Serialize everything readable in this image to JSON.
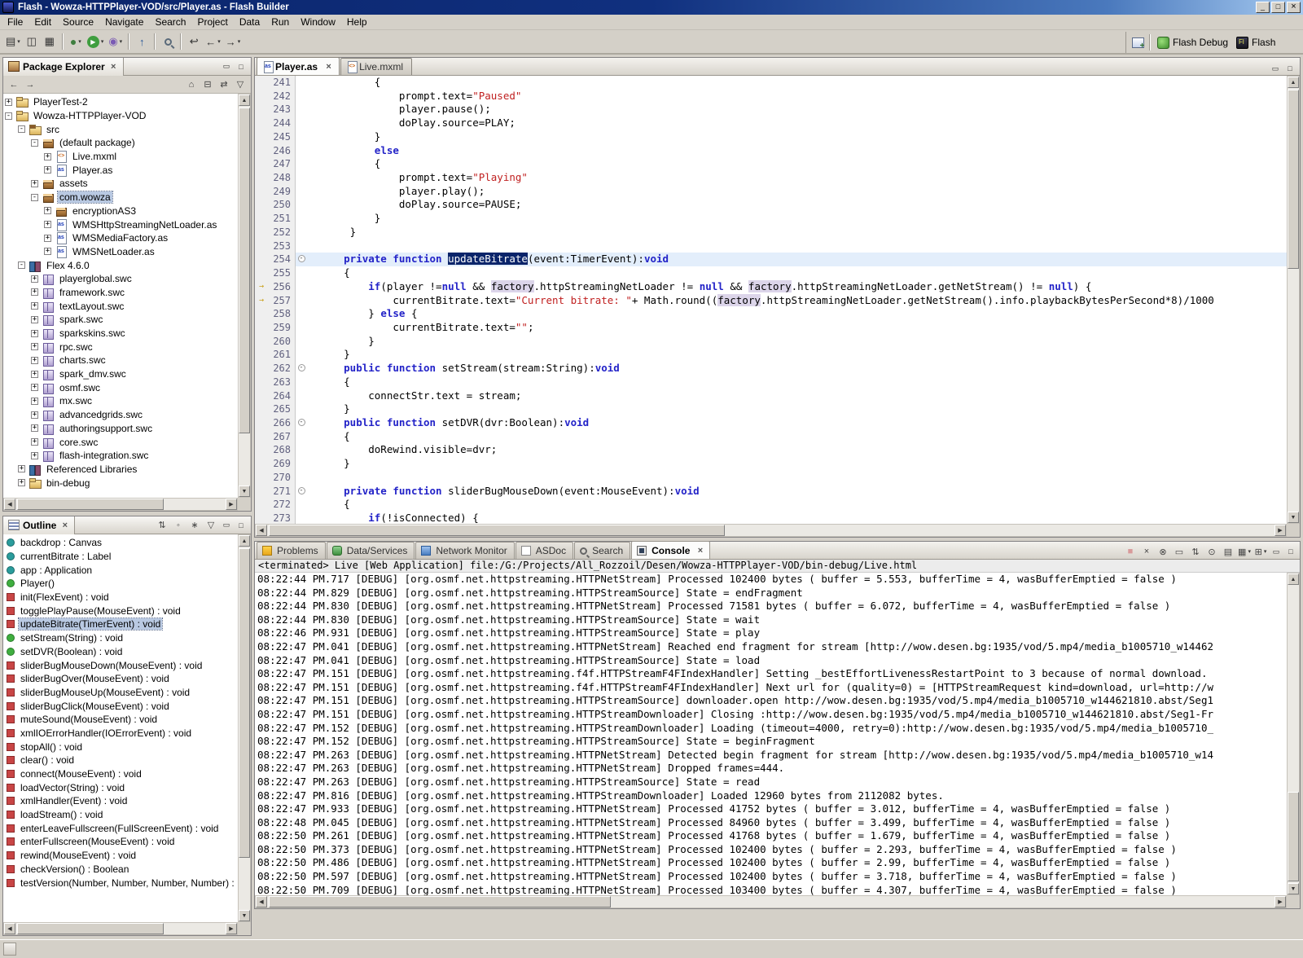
{
  "window": {
    "title": "Flash - Wowza-HTTPPlayer-VOD/src/Player.as - Flash Builder",
    "menus": [
      "File",
      "Edit",
      "Source",
      "Navigate",
      "Search",
      "Project",
      "Data",
      "Run",
      "Window",
      "Help"
    ]
  },
  "toolbar": {
    "buttons": [
      {
        "name": "new",
        "glyph": "▤",
        "dropdown": true
      },
      {
        "name": "save",
        "glyph": "◫"
      },
      {
        "name": "print",
        "glyph": "▦"
      },
      {
        "sep": true
      },
      {
        "name": "debug",
        "glyph": "●",
        "cls": "g-debug",
        "dropdown": true
      },
      {
        "name": "run",
        "glyph": "▶",
        "cls": "g-run",
        "dropdown": true
      },
      {
        "name": "profile",
        "glyph": "◉",
        "cls": "g-prof",
        "dropdown": true
      },
      {
        "sep": true
      },
      {
        "name": "export-release-build",
        "glyph": "↑",
        "cls": "g-exp"
      },
      {
        "sep": true
      },
      {
        "name": "search",
        "search": true
      },
      {
        "sep": true
      },
      {
        "name": "last-edit-location",
        "glyph": "↩"
      },
      {
        "name": "back",
        "glyph": "←",
        "dropdown": true
      },
      {
        "name": "forward",
        "glyph": "→",
        "dropdown": true
      }
    ],
    "perspectives": [
      {
        "label": "Flash Debug",
        "icon": "flash-debug"
      },
      {
        "label": "Flash",
        "icon": "flash"
      }
    ]
  },
  "package_explorer": {
    "title": "Package Explorer",
    "toolbar_left": [
      {
        "name": "back-history",
        "glyph": "←"
      },
      {
        "name": "forward-history",
        "glyph": "→"
      }
    ],
    "toolbar_right": [
      {
        "name": "go-up",
        "glyph": "⌂"
      },
      {
        "name": "collapse-all",
        "glyph": "⊟"
      },
      {
        "name": "link-with-editor",
        "glyph": "⇄"
      },
      {
        "name": "view-menu",
        "glyph": "▽"
      }
    ],
    "items": [
      {
        "label": "PlayerTest-2",
        "depth": 0,
        "icon": "project",
        "exp": "+"
      },
      {
        "label": "Wowza-HTTPPlayer-VOD",
        "depth": 0,
        "icon": "project",
        "exp": "-"
      },
      {
        "label": "src",
        "depth": 1,
        "icon": "src",
        "exp": "-"
      },
      {
        "label": "(default package)",
        "depth": 2,
        "icon": "package",
        "exp": "-"
      },
      {
        "label": "Live.mxml",
        "depth": 3,
        "icon": "mxml",
        "exp": "+"
      },
      {
        "label": "Player.as",
        "depth": 3,
        "icon": "as",
        "exp": "+"
      },
      {
        "label": "assets",
        "depth": 2,
        "icon": "package",
        "exp": "+"
      },
      {
        "label": "com.wowza",
        "depth": 2,
        "icon": "package",
        "exp": "-",
        "selected": true
      },
      {
        "label": "encryptionAS3",
        "depth": 3,
        "icon": "package",
        "exp": "+"
      },
      {
        "label": "WMSHttpStreamingNetLoader.as",
        "depth": 3,
        "icon": "as",
        "exp": "+"
      },
      {
        "label": "WMSMediaFactory.as",
        "depth": 3,
        "icon": "as",
        "exp": "+"
      },
      {
        "label": "WMSNetLoader.as",
        "depth": 3,
        "icon": "as",
        "exp": "+"
      },
      {
        "label": "Flex 4.6.0",
        "depth": 1,
        "icon": "lib",
        "exp": "-"
      },
      {
        "label": "playerglobal.swc",
        "depth": 2,
        "icon": "swc",
        "exp": "+"
      },
      {
        "label": "framework.swc",
        "depth": 2,
        "icon": "swc",
        "exp": "+"
      },
      {
        "label": "textLayout.swc",
        "depth": 2,
        "icon": "swc",
        "exp": "+"
      },
      {
        "label": "spark.swc",
        "depth": 2,
        "icon": "swc",
        "exp": "+"
      },
      {
        "label": "sparkskins.swc",
        "depth": 2,
        "icon": "swc",
        "exp": "+"
      },
      {
        "label": "rpc.swc",
        "depth": 2,
        "icon": "swc",
        "exp": "+"
      },
      {
        "label": "charts.swc",
        "depth": 2,
        "icon": "swc",
        "exp": "+"
      },
      {
        "label": "spark_dmv.swc",
        "depth": 2,
        "icon": "swc",
        "exp": "+"
      },
      {
        "label": "osmf.swc",
        "depth": 2,
        "icon": "swc",
        "exp": "+"
      },
      {
        "label": "mx.swc",
        "depth": 2,
        "icon": "swc",
        "exp": "+"
      },
      {
        "label": "advancedgrids.swc",
        "depth": 2,
        "icon": "swc",
        "exp": "+"
      },
      {
        "label": "authoringsupport.swc",
        "depth": 2,
        "icon": "swc",
        "exp": "+"
      },
      {
        "label": "core.swc",
        "depth": 2,
        "icon": "swc",
        "exp": "+"
      },
      {
        "label": "flash-integration.swc",
        "depth": 2,
        "icon": "swc",
        "exp": "+"
      },
      {
        "label": "Referenced Libraries",
        "depth": 1,
        "icon": "lib",
        "exp": "+"
      },
      {
        "label": "bin-debug",
        "depth": 1,
        "icon": "folder",
        "exp": "+"
      }
    ]
  },
  "outline": {
    "title": "Outline",
    "toolbar": [
      {
        "name": "sort",
        "glyph": "⇅"
      },
      {
        "name": "hide-fields",
        "glyph": "◦"
      },
      {
        "name": "hide-static",
        "glyph": "∗"
      },
      {
        "name": "outline-view-menu",
        "glyph": "▽"
      }
    ],
    "items": [
      {
        "label": "backdrop : Canvas",
        "kind": "field"
      },
      {
        "label": "currentBitrate : Label",
        "kind": "field"
      },
      {
        "label": "app : Application",
        "kind": "field"
      },
      {
        "label": "Player()",
        "kind": "public"
      },
      {
        "label": "init(FlexEvent) : void",
        "kind": "private"
      },
      {
        "label": "togglePlayPause(MouseEvent) : void",
        "kind": "private"
      },
      {
        "label": "updateBitrate(TimerEvent) : void",
        "kind": "private",
        "selected": true
      },
      {
        "label": "setStream(String) : void",
        "kind": "public"
      },
      {
        "label": "setDVR(Boolean) : void",
        "kind": "public"
      },
      {
        "label": "sliderBugMouseDown(MouseEvent) : void",
        "kind": "private"
      },
      {
        "label": "sliderBugOver(MouseEvent) : void",
        "kind": "private"
      },
      {
        "label": "sliderBugMouseUp(MouseEvent) : void",
        "kind": "private"
      },
      {
        "label": "sliderBugClick(MouseEvent) : void",
        "kind": "private"
      },
      {
        "label": "muteSound(MouseEvent) : void",
        "kind": "private"
      },
      {
        "label": "xmlIOErrorHandler(IOErrorEvent) : void",
        "kind": "private"
      },
      {
        "label": "stopAll() : void",
        "kind": "private"
      },
      {
        "label": "clear() : void",
        "kind": "private"
      },
      {
        "label": "connect(MouseEvent) : void",
        "kind": "private"
      },
      {
        "label": "loadVector(String) : void",
        "kind": "private"
      },
      {
        "label": "xmlHandler(Event) : void",
        "kind": "private"
      },
      {
        "label": "loadStream() : void",
        "kind": "private"
      },
      {
        "label": "enterLeaveFullscreen(FullScreenEvent) : void",
        "kind": "private"
      },
      {
        "label": "enterFullscreen(MouseEvent) : void",
        "kind": "private"
      },
      {
        "label": "rewind(MouseEvent) : void",
        "kind": "private"
      },
      {
        "label": "checkVersion() : Boolean",
        "kind": "private"
      },
      {
        "label": "testVersion(Number, Number, Number, Number) : Boolean",
        "kind": "private"
      }
    ]
  },
  "editor": {
    "tabs": [
      {
        "label": "Player.as",
        "icon": "as",
        "active": true
      },
      {
        "label": "Live.mxml",
        "icon": "mxml",
        "active": false
      }
    ],
    "keywords": [
      "private",
      "public",
      "function",
      "if",
      "else",
      "null",
      "void"
    ],
    "lines": [
      {
        "n": 241,
        "t": "           {"
      },
      {
        "n": 242,
        "t": "               prompt.text=\"Paused\""
      },
      {
        "n": 243,
        "t": "               player.pause();"
      },
      {
        "n": 244,
        "t": "               doPlay.source=PLAY;"
      },
      {
        "n": 245,
        "t": "           }"
      },
      {
        "n": 246,
        "t": "           else"
      },
      {
        "n": 247,
        "t": "           {"
      },
      {
        "n": 248,
        "t": "               prompt.text=\"Playing\""
      },
      {
        "n": 249,
        "t": "               player.play();"
      },
      {
        "n": 250,
        "t": "               doPlay.source=PAUSE;"
      },
      {
        "n": 251,
        "t": "           }"
      },
      {
        "n": 252,
        "t": "       }"
      },
      {
        "n": 253,
        "t": ""
      },
      {
        "n": 254,
        "t": "      private function updateBitrate(event:TimerEvent):void",
        "fold": true,
        "hl": true,
        "sel": "updateBitrate"
      },
      {
        "n": 255,
        "t": "      {"
      },
      {
        "n": 256,
        "t": "          if(player !=null && factory.httpStreamingNetLoader != null && factory.httpStreamingNetLoader.getNetStream() != null) {",
        "occ": "factory",
        "mark": true
      },
      {
        "n": 257,
        "t": "              currentBitrate.text=\"Current bitrate: \"+ Math.round((factory.httpStreamingNetLoader.getNetStream().info.playbackBytesPerSecond*8)/1000",
        "occ": "factory",
        "mark": true
      },
      {
        "n": 258,
        "t": "          } else {"
      },
      {
        "n": 259,
        "t": "              currentBitrate.text=\"\";"
      },
      {
        "n": 260,
        "t": "          }"
      },
      {
        "n": 261,
        "t": "      }"
      },
      {
        "n": 262,
        "t": "      public function setStream(stream:String):void",
        "fold": true
      },
      {
        "n": 263,
        "t": "      {"
      },
      {
        "n": 264,
        "t": "          connectStr.text = stream;"
      },
      {
        "n": 265,
        "t": "      }"
      },
      {
        "n": 266,
        "t": "      public function setDVR(dvr:Boolean):void",
        "fold": true
      },
      {
        "n": 267,
        "t": "      {"
      },
      {
        "n": 268,
        "t": "          doRewind.visible=dvr;"
      },
      {
        "n": 269,
        "t": "      }"
      },
      {
        "n": 270,
        "t": ""
      },
      {
        "n": 271,
        "t": "      private function sliderBugMouseDown(event:MouseEvent):void",
        "fold": true
      },
      {
        "n": 272,
        "t": "      {"
      },
      {
        "n": 273,
        "t": "          if(!isConnected) {"
      }
    ]
  },
  "console": {
    "tabs": [
      {
        "label": "Problems",
        "icon": "problems"
      },
      {
        "label": "Data/Services",
        "icon": "data"
      },
      {
        "label": "Network Monitor",
        "icon": "network"
      },
      {
        "label": "ASDoc",
        "icon": "asdoc"
      },
      {
        "label": "Search",
        "icon": "search"
      },
      {
        "label": "Console",
        "icon": "console",
        "active": true
      }
    ],
    "toolbar": [
      {
        "name": "terminate",
        "glyph": "■",
        "cls": "dis-red"
      },
      {
        "name": "remove-launch",
        "glyph": "×"
      },
      {
        "name": "remove-all-launches",
        "glyph": "⊗"
      },
      {
        "name": "clear-console",
        "glyph": "▭"
      },
      {
        "name": "scroll-lock",
        "glyph": "⇅"
      },
      {
        "name": "pin-console",
        "glyph": "⊙"
      },
      {
        "name": "show-on-output",
        "glyph": "▤"
      },
      {
        "name": "display-selected-console",
        "glyph": "▦",
        "dropdown": true
      },
      {
        "name": "open-console",
        "glyph": "⊞",
        "dropdown": true
      }
    ],
    "terminated": "<terminated> Live [Web Application] file:/G:/Projects/All_Rozzoil/Desen/Wowza-HTTPPlayer-VOD/bin-debug/Live.html",
    "log": [
      "08:22:44 PM.717 [DEBUG] [org.osmf.net.httpstreaming.HTTPNetStream] Processed 102400 bytes ( buffer = 5.553, bufferTime = 4, wasBufferEmptied = false )",
      "08:22:44 PM.829 [DEBUG] [org.osmf.net.httpstreaming.HTTPStreamSource] State = endFragment",
      "08:22:44 PM.830 [DEBUG] [org.osmf.net.httpstreaming.HTTPNetStream] Processed 71581 bytes ( buffer = 6.072, bufferTime = 4, wasBufferEmptied = false )",
      "08:22:44 PM.830 [DEBUG] [org.osmf.net.httpstreaming.HTTPStreamSource] State = wait",
      "08:22:46 PM.931 [DEBUG] [org.osmf.net.httpstreaming.HTTPStreamSource] State = play",
      "08:22:47 PM.041 [DEBUG] [org.osmf.net.httpstreaming.HTTPNetStream] Reached end fragment for stream [http://wow.desen.bg:1935/vod/5.mp4/media_b1005710_w14462",
      "08:22:47 PM.041 [DEBUG] [org.osmf.net.httpstreaming.HTTPStreamSource] State = load",
      "08:22:47 PM.151 [DEBUG] [org.osmf.net.httpstreaming.f4f.HTTPStreamF4FIndexHandler] Setting _bestEffortLivenessRestartPoint to 3 because of normal download.",
      "08:22:47 PM.151 [DEBUG] [org.osmf.net.httpstreaming.f4f.HTTPStreamF4FIndexHandler] Next url for (quality=0) = [HTTPStreamRequest kind=download, url=http://w",
      "08:22:47 PM.151 [DEBUG] [org.osmf.net.httpstreaming.HTTPStreamSource] downloader.open http://wow.desen.bg:1935/vod/5.mp4/media_b1005710_w144621810.abst/Seg1",
      "08:22:47 PM.151 [DEBUG] [org.osmf.net.httpstreaming.HTTPStreamDownloader] Closing :http://wow.desen.bg:1935/vod/5.mp4/media_b1005710_w144621810.abst/Seg1-Fr",
      "08:22:47 PM.152 [DEBUG] [org.osmf.net.httpstreaming.HTTPStreamDownloader] Loading (timeout=4000, retry=0):http://wow.desen.bg:1935/vod/5.mp4/media_b1005710_",
      "08:22:47 PM.152 [DEBUG] [org.osmf.net.httpstreaming.HTTPStreamSource] State = beginFragment",
      "08:22:47 PM.263 [DEBUG] [org.osmf.net.httpstreaming.HTTPNetStream] Detected begin fragment for stream [http://wow.desen.bg:1935/vod/5.mp4/media_b1005710_w14",
      "08:22:47 PM.263 [DEBUG] [org.osmf.net.httpstreaming.HTTPNetStream] Dropped frames=444.",
      "08:22:47 PM.263 [DEBUG] [org.osmf.net.httpstreaming.HTTPStreamSource] State = read",
      "08:22:47 PM.816 [DEBUG] [org.osmf.net.httpstreaming.HTTPStreamDownloader] Loaded 12960 bytes from 2112082 bytes.",
      "08:22:47 PM.933 [DEBUG] [org.osmf.net.httpstreaming.HTTPNetStream] Processed 41752 bytes ( buffer = 3.012, bufferTime = 4, wasBufferEmptied = false )",
      "08:22:48 PM.045 [DEBUG] [org.osmf.net.httpstreaming.HTTPNetStream] Processed 84960 bytes ( buffer = 3.499, bufferTime = 4, wasBufferEmptied = false )",
      "08:22:50 PM.261 [DEBUG] [org.osmf.net.httpstreaming.HTTPNetStream] Processed 41768 bytes ( buffer = 1.679, bufferTime = 4, wasBufferEmptied = false )",
      "08:22:50 PM.373 [DEBUG] [org.osmf.net.httpstreaming.HTTPNetStream] Processed 102400 bytes ( buffer = 2.293, bufferTime = 4, wasBufferEmptied = false )",
      "08:22:50 PM.486 [DEBUG] [org.osmf.net.httpstreaming.HTTPNetStream] Processed 102400 bytes ( buffer = 2.99, bufferTime = 4, wasBufferEmptied = false )",
      "08:22:50 PM.597 [DEBUG] [org.osmf.net.httpstreaming.HTTPNetStream] Processed 102400 bytes ( buffer = 3.718, bufferTime = 4, wasBufferEmptied = false )",
      "08:22:50 PM.709 [DEBUG] [org.osmf.net.httpstreaming.HTTPNetStream] Processed 103400 bytes ( buffer = 4.307, bufferTime = 4, wasBufferEmptied = false )"
    ]
  }
}
